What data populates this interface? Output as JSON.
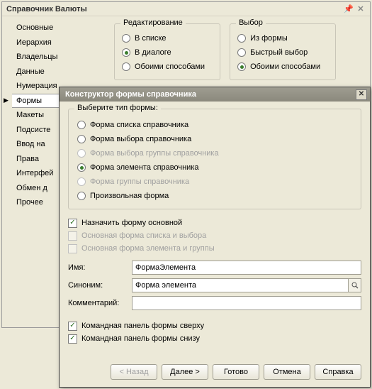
{
  "bg": {
    "title": "Справочник Валюты",
    "nav": [
      {
        "label": "Основные"
      },
      {
        "label": "Иерархия"
      },
      {
        "label": "Владельцы"
      },
      {
        "label": "Данные"
      },
      {
        "label": "Нумерация"
      },
      {
        "label": "Формы"
      },
      {
        "label": "Макеты"
      },
      {
        "label": "Подсисте"
      },
      {
        "label": "Ввод на"
      },
      {
        "label": "Права"
      },
      {
        "label": "Интерфей"
      },
      {
        "label": "Обмен д"
      },
      {
        "label": "Прочее"
      }
    ],
    "edit_group": {
      "legend": "Редактирование",
      "options": [
        {
          "label": "В списке",
          "checked": false
        },
        {
          "label": "В диалоге",
          "checked": true
        },
        {
          "label": "Обоими способами",
          "checked": false
        }
      ]
    },
    "choice_group": {
      "legend": "Выбор",
      "options": [
        {
          "label": "Из формы",
          "checked": false
        },
        {
          "label": "Быстрый выбор",
          "checked": false
        },
        {
          "label": "Обоими способами",
          "checked": true
        }
      ]
    }
  },
  "dialog": {
    "title": "Конструктор формы справочника",
    "form_type_legend": "Выберите тип формы:",
    "form_types": [
      {
        "label": "Форма списка справочника",
        "checked": false,
        "disabled": false
      },
      {
        "label": "Форма выбора справочника",
        "checked": false,
        "disabled": false
      },
      {
        "label": "Форма выбора группы справочника",
        "checked": false,
        "disabled": true
      },
      {
        "label": "Форма элемента справочника",
        "checked": true,
        "disabled": false
      },
      {
        "label": "Форма группы справочника",
        "checked": false,
        "disabled": true
      },
      {
        "label": "Произвольная форма",
        "checked": false,
        "disabled": false
      }
    ],
    "checks": [
      {
        "label": "Назначить форму основной",
        "checked": true,
        "disabled": false
      },
      {
        "label": "Основная форма списка и выбора",
        "checked": false,
        "disabled": true
      },
      {
        "label": "Основная форма элемента и группы",
        "checked": false,
        "disabled": true
      }
    ],
    "fields": {
      "name_label": "Имя:",
      "name_value": "ФормаЭлемента",
      "synonym_label": "Синоним:",
      "synonym_value": "Форма элемента",
      "comment_label": "Комментарий:",
      "comment_value": ""
    },
    "panel_checks": [
      {
        "label": "Командная панель формы сверху",
        "checked": true
      },
      {
        "label": "Командная панель формы снизу",
        "checked": true
      }
    ],
    "buttons": {
      "back": "< Назад",
      "next": "Далее >",
      "finish": "Готово",
      "cancel": "Отмена",
      "help": "Справка"
    }
  }
}
